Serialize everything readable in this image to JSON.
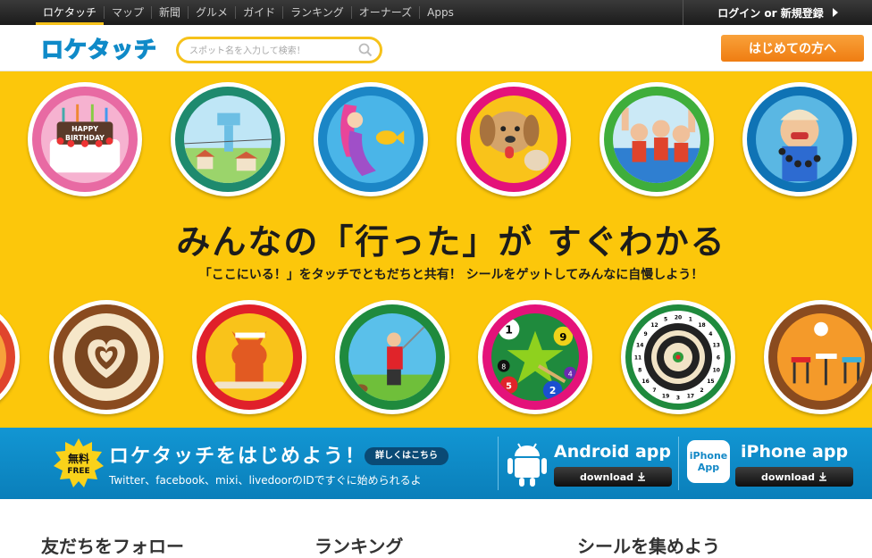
{
  "topnav": {
    "items": [
      "ロケタッチ",
      "マップ",
      "新聞",
      "グルメ",
      "ガイド",
      "ランキング",
      "オーナーズ",
      "Apps"
    ],
    "login_label": "ログイン or 新規登録"
  },
  "header": {
    "logo_text": "ロケタッチ",
    "search_placeholder": "スポット名を入力して検索！",
    "first_button": "はじめての方へ"
  },
  "hero": {
    "headline": "みんなの「行った」が すぐわかる",
    "subline": "「ここにいる！」をタッチでともだちと共有！ シールをゲットしてみんなに自慢しよう！",
    "cake_text_1": "HAPPY",
    "cake_text_2": "BIRTHDAY",
    "top_badges": [
      "birthday-cake",
      "water-tower",
      "mermaid",
      "dog",
      "cheering-crowd",
      "monk"
    ],
    "bottom_badges": [
      "latte-art",
      "fox-baker",
      "golfer",
      "billiard-balls",
      "dartboard",
      "cafe-chairs"
    ],
    "billiard_numbers": [
      "1",
      "9",
      "8",
      "5",
      "2",
      "4"
    ],
    "dart_numbers": [
      "20",
      "1",
      "18",
      "4",
      "13",
      "6",
      "10",
      "15",
      "2",
      "17",
      "3",
      "19",
      "7",
      "16",
      "8",
      "11",
      "14",
      "9",
      "12",
      "5"
    ]
  },
  "band": {
    "free_badge": [
      "無料",
      "FREE"
    ],
    "title": "ロケタッチをはじめよう！",
    "details": "詳しくはこちら",
    "subtitle": "Twitter、facebook、mixi、livedoorのIDですぐに始められるよ",
    "android_title": "Android app",
    "android_download": "download",
    "iphone_icon": "iPhone App",
    "iphone_title": "iPhone app",
    "iphone_download": "download"
  },
  "bottom_peek": [
    "友だちをフォロー",
    "ランキング",
    "シールを集めよう"
  ],
  "colors": {
    "hero_yellow": "#fcc70b",
    "band_blue": "#1296d3",
    "accent_orange": "#ef7d12",
    "nav_dark": "#222222"
  }
}
